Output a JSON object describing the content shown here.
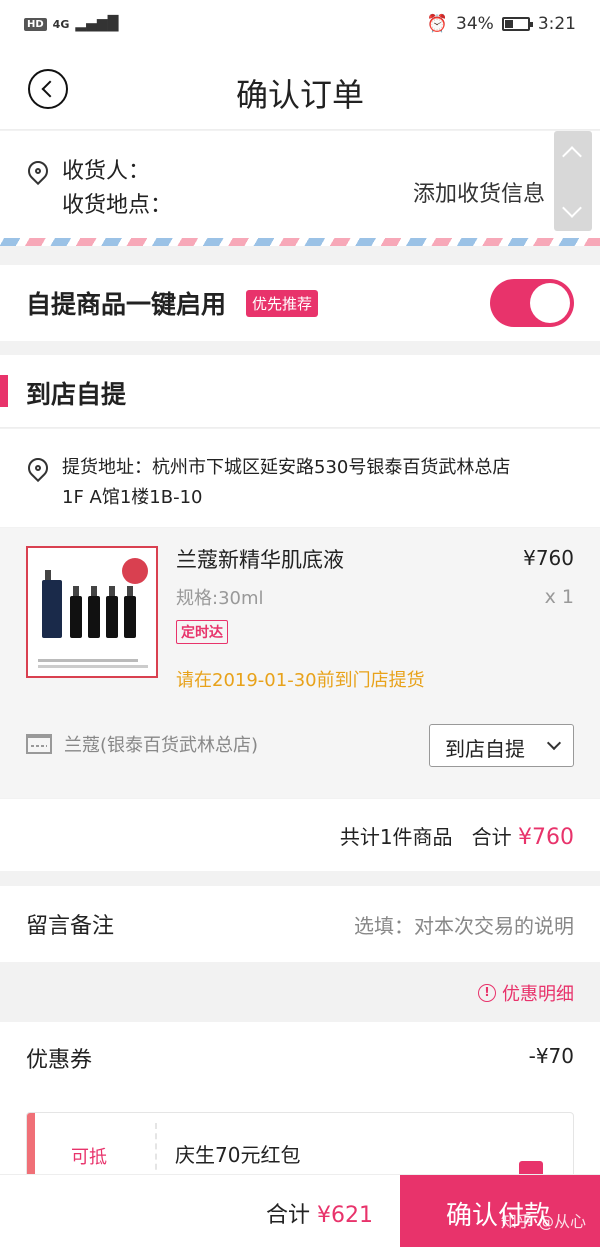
{
  "status_bar": {
    "hd": "HD",
    "signal": "4G",
    "battery": "34%",
    "time": "3:21"
  },
  "header": {
    "title": "确认订单"
  },
  "address": {
    "receiver_label": "收货人：",
    "location_label": "收货地点：",
    "add_info": "添加收货信息"
  },
  "pickup_toggle": {
    "label": "自提商品一键启用",
    "badge": "优先推荐",
    "enabled": true
  },
  "store_section": {
    "title": "到店自提",
    "pickup_address": "提货地址：杭州市下城区延安路530号银泰百货武林总店 1F A馆1楼1B-10"
  },
  "product": {
    "name": "兰蔻新精华肌底液",
    "price": "¥760",
    "spec": "规格:30ml",
    "qty": "x 1",
    "tag": "定时达",
    "note": "请在2019-01-30前到门店提货",
    "shop": "兰蔻(银泰百货武林总店)",
    "method": "到店自提"
  },
  "summary": {
    "count_text": "共计1件商品",
    "total_label": "合计",
    "total_value": "¥760"
  },
  "remark": {
    "label": "留言备注",
    "placeholder": "选填：对本次交易的说明"
  },
  "discount": {
    "detail_link": "优惠明细"
  },
  "coupon": {
    "label": "优惠券",
    "amount": "-¥70",
    "deduct": "可抵",
    "name": "庆生70元红包"
  },
  "bottom": {
    "total_label": "合计",
    "total_value": "¥621",
    "confirm": "确认付款",
    "watermark": "知乎 @从心"
  },
  "colors": {
    "accent": "#e8336b",
    "warning": "#e8a21a"
  }
}
